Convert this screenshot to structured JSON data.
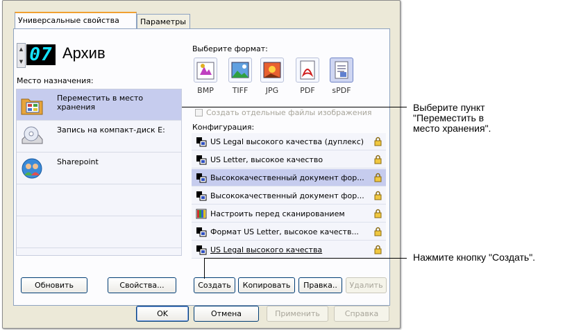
{
  "tabs": [
    {
      "label": "Универсальные свойства"
    },
    {
      "label": "Параметры"
    }
  ],
  "profile": {
    "counter": "07",
    "name": "Архив"
  },
  "destination": {
    "label": "Место назначения:",
    "items": [
      {
        "label": "Переместить в место хранения",
        "icon": "storage-folder-icon",
        "selected": true
      },
      {
        "label": "Запись на компакт-диск  E:",
        "icon": "cd-drive-icon",
        "selected": false
      },
      {
        "label": "Sharepoint",
        "icon": "sharepoint-icon",
        "selected": false
      }
    ]
  },
  "format": {
    "label": "Выберите формат:",
    "items": [
      {
        "label": "BMP",
        "icon": "bmp-icon"
      },
      {
        "label": "TIFF",
        "icon": "tiff-icon"
      },
      {
        "label": "JPG",
        "icon": "jpg-icon"
      },
      {
        "label": "PDF",
        "icon": "pdf-icon"
      },
      {
        "label": "sPDF",
        "icon": "spdf-icon"
      }
    ],
    "selected": "sPDF",
    "separate_files_label": "Создать отдельные файлы изображения"
  },
  "configuration": {
    "label": "Конфигурация:",
    "items": [
      {
        "label": "US Legal высокого качества (дуплекс)",
        "icon": "scan-config-icon",
        "locked": true
      },
      {
        "label": "US Letter, высокое качество",
        "icon": "scan-config-icon",
        "locked": true
      },
      {
        "label": "Высококачественный документ фор...",
        "icon": "scan-config-icon",
        "locked": true,
        "selected": true
      },
      {
        "label": "Высококачественный документ фор...",
        "icon": "scan-config-icon",
        "locked": true
      },
      {
        "label": "Настроить перед сканированием",
        "icon": "configure-before-scan-icon",
        "locked": true
      },
      {
        "label": "Формат US Letter, высокое качеств...",
        "icon": "scan-config-icon",
        "locked": true
      },
      {
        "label": "US Legal высокого качества",
        "icon": "scan-config-icon",
        "locked": true
      }
    ]
  },
  "buttons": {
    "refresh": "Обновить",
    "properties": "Свойства...",
    "create": "Создать",
    "copy": "Копировать",
    "edit": "Правка..",
    "delete": "Удалить",
    "ok": "OK",
    "cancel": "Отмена",
    "apply": "Применить",
    "help": "Справка"
  },
  "callouts": {
    "select_item": [
      "Выберите пункт",
      "\"Переместить в",
      "место хранения\"."
    ],
    "press_create": "Нажмите кнопку \"Создать\"."
  },
  "colors": {
    "lcd_text": "#15e3ff",
    "selection": "#c6ccee",
    "tab_highlight": "#f0a030"
  }
}
